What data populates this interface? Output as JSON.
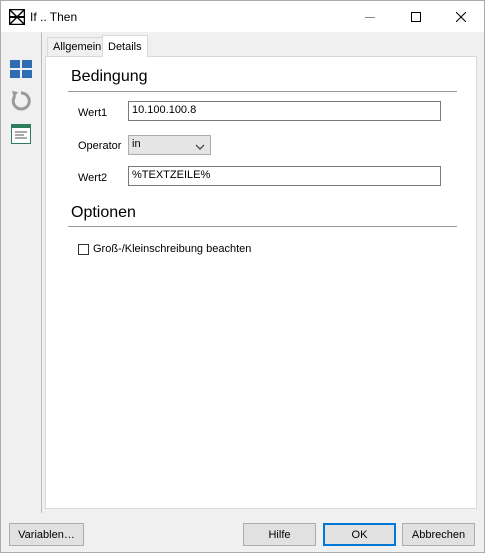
{
  "window": {
    "title": "If .. Then"
  },
  "tabs": [
    {
      "label": "Allgemein"
    },
    {
      "label": "Details"
    }
  ],
  "condition": {
    "heading": "Bedingung",
    "value1_label": "Wert1",
    "value1": "10.100.100.8",
    "operator_label": "Operator",
    "operator": "in",
    "value2_label": "Wert2",
    "value2": "%TEXTZEILE%"
  },
  "options": {
    "heading": "Optionen",
    "case_sensitive_label": "Groß-/Kleinschreibung beachten",
    "case_sensitive": false
  },
  "buttons": {
    "variables": "Variablen…",
    "help": "Hilfe",
    "ok": "OK",
    "cancel": "Abbrechen"
  },
  "icons": [
    "app-icon",
    "minimize-icon",
    "maximize-icon",
    "close-icon",
    "grid-icon",
    "refresh-icon",
    "list-icon",
    "chevron-down-icon"
  ],
  "colors": {
    "accent": "#0078d7",
    "tool_blue": "#2e6db4"
  }
}
